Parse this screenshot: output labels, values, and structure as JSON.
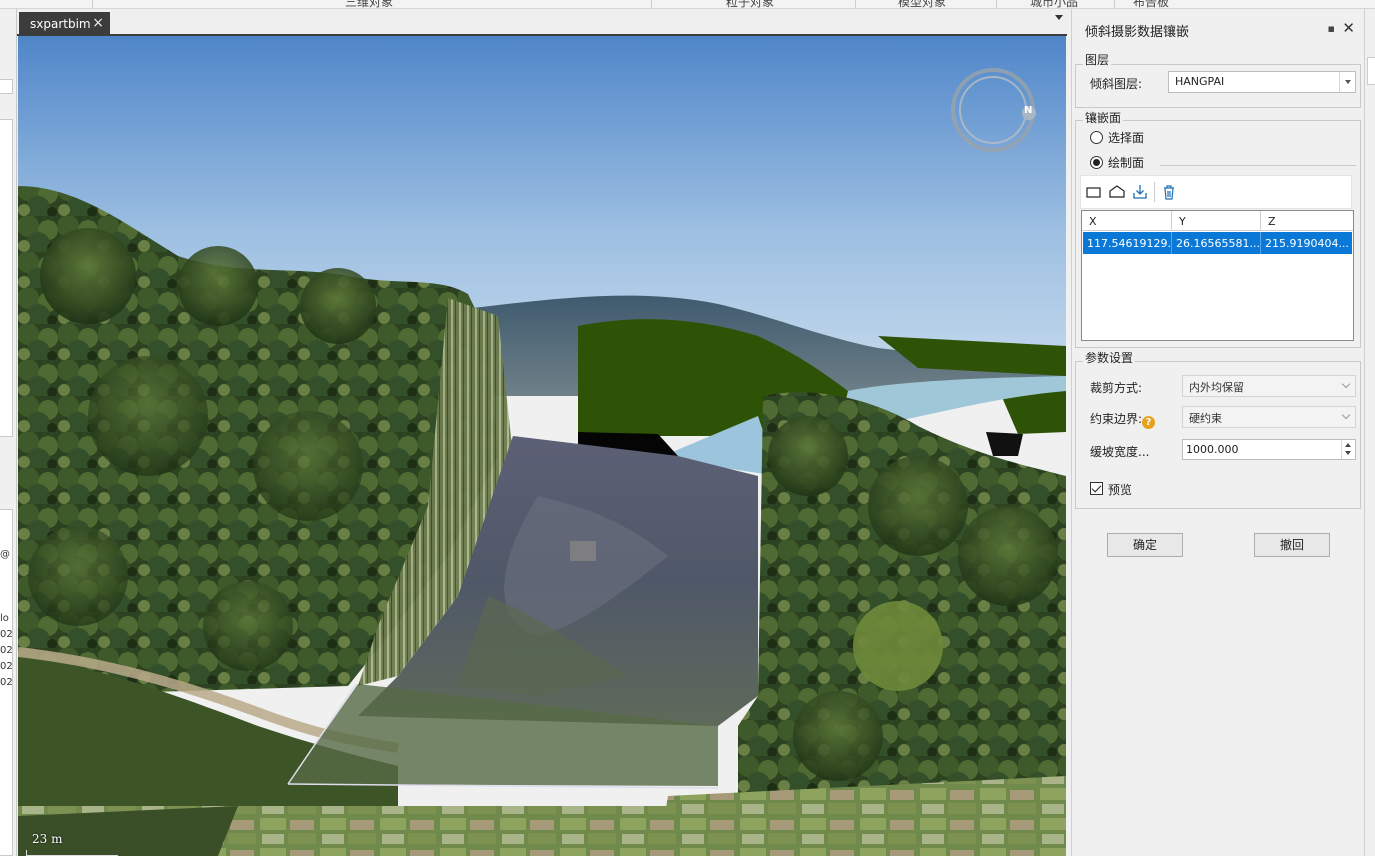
{
  "ribbon": {
    "items": [
      "三维对象",
      "粒子对象",
      "模型对象",
      "城市小品",
      "布告板"
    ]
  },
  "document": {
    "tab_label": "sxpartbim",
    "close_glyph": "×"
  },
  "left_dock": {
    "fragments": [
      "@",
      "lo",
      "02",
      "02",
      "02",
      "02"
    ]
  },
  "scene": {
    "scale_label": "23 m",
    "compass_letter": "N"
  },
  "panel": {
    "title": "倾斜摄影数据镶嵌",
    "pin_glyph": "📌",
    "close_glyph": "✕",
    "layer_group": {
      "label": "图层",
      "field_label": "倾斜图层:",
      "value": "HANGPAI"
    },
    "surface_group": {
      "label": "镶嵌面",
      "option_select": "选择面",
      "option_draw": "绘制面",
      "selected": "绘制面",
      "tools": [
        "rectangle-icon",
        "polygon-icon",
        "import-icon",
        "delete-icon"
      ],
      "grid": {
        "columns": [
          "X",
          "Y",
          "Z"
        ],
        "rows": [
          [
            "117.54619129...",
            "26.16565581...",
            "215.9190404..."
          ]
        ]
      }
    },
    "params_group": {
      "label": "参数设置",
      "clip_label": "裁剪方式:",
      "clip_value": "内外均保留",
      "boundary_label": "约束边界:",
      "boundary_value": "硬约束",
      "slope_label": "缓坡宽度...",
      "slope_value": "1000.000",
      "preview_label": "预览",
      "preview_checked": true
    },
    "ok_label": "确定",
    "cancel_label": "撤回"
  }
}
